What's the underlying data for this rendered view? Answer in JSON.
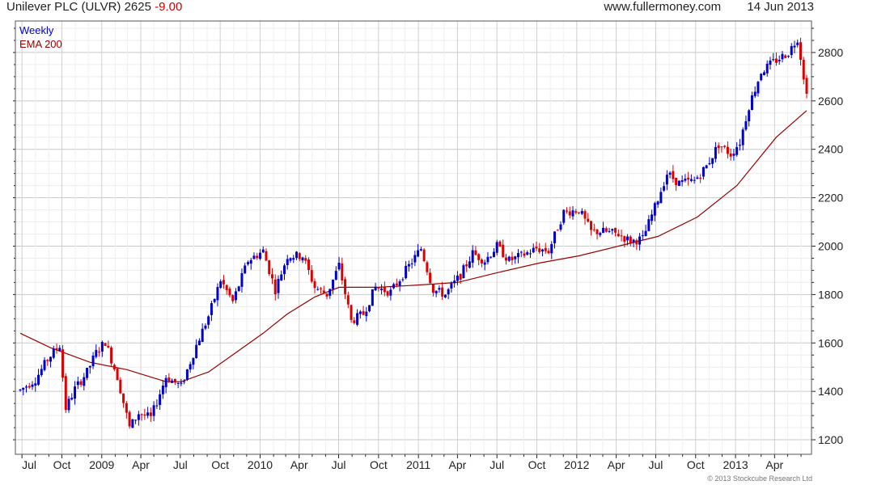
{
  "header": {
    "title": "Unilever PLC (ULVR) 2625",
    "change": "-9.00",
    "site": "www.fullermoney.com",
    "date": "14 Jun 2013"
  },
  "legend": {
    "series1": "Weekly",
    "series2": "EMA 200"
  },
  "copyright": "© 2013 Stockcube Research Ltd",
  "colors": {
    "up": "#0000cc",
    "down": "#dd0000",
    "ema": "#990000",
    "grid": "#d6d6d6",
    "axis": "#222222"
  },
  "chart_data": {
    "type": "candlestick",
    "title": "Unilever PLC (ULVR) 2625 -9.00",
    "x_tick_labels": [
      "Jul",
      "Oct",
      "2009",
      "Apr",
      "Jul",
      "Oct",
      "2010",
      "Apr",
      "Jul",
      "Oct",
      "2011",
      "Apr",
      "Jul",
      "Oct",
      "2012",
      "Apr",
      "Jul",
      "Oct",
      "2013",
      "Apr"
    ],
    "x_tick_dates": [
      "2008-07-01",
      "2008-10-01",
      "2009-01-01",
      "2009-04-01",
      "2009-07-01",
      "2009-10-01",
      "2010-01-01",
      "2010-04-01",
      "2010-07-01",
      "2010-10-01",
      "2011-01-01",
      "2011-04-01",
      "2011-07-01",
      "2011-10-01",
      "2012-01-01",
      "2012-04-01",
      "2012-07-01",
      "2012-10-01",
      "2013-01-01",
      "2013-04-01"
    ],
    "x_range": [
      "2008-06-27",
      "2013-06-14"
    ],
    "y_ticks": [
      1200,
      1400,
      1600,
      1800,
      2000,
      2200,
      2400,
      2600,
      2800
    ],
    "ylim": [
      1140,
      2930
    ],
    "grid": true,
    "legend_position": "top-left",
    "series": [
      {
        "name": "Weekly",
        "points": [
          [
            "2008-06-27",
            1405
          ],
          [
            "2008-08-01",
            1450
          ],
          [
            "2008-09-01",
            1540
          ],
          [
            "2008-09-26",
            1590
          ],
          [
            "2008-10-10",
            1330
          ],
          [
            "2008-10-31",
            1410
          ],
          [
            "2008-11-28",
            1480
          ],
          [
            "2008-12-19",
            1560
          ],
          [
            "2009-01-09",
            1605
          ],
          [
            "2009-02-06",
            1460
          ],
          [
            "2009-03-06",
            1250
          ],
          [
            "2009-03-27",
            1310
          ],
          [
            "2009-04-24",
            1290
          ],
          [
            "2009-05-29",
            1460
          ],
          [
            "2009-07-03",
            1420
          ],
          [
            "2009-08-07",
            1590
          ],
          [
            "2009-09-04",
            1710
          ],
          [
            "2009-10-02",
            1860
          ],
          [
            "2009-10-30",
            1770
          ],
          [
            "2009-12-04",
            1940
          ],
          [
            "2010-01-08",
            1980
          ],
          [
            "2010-02-05",
            1820
          ],
          [
            "2010-03-05",
            1960
          ],
          [
            "2010-04-09",
            1960
          ],
          [
            "2010-05-07",
            1830
          ],
          [
            "2010-06-04",
            1800
          ],
          [
            "2010-07-02",
            1920
          ],
          [
            "2010-07-30",
            1690
          ],
          [
            "2010-08-27",
            1720
          ],
          [
            "2010-09-24",
            1830
          ],
          [
            "2010-10-29",
            1810
          ],
          [
            "2010-12-03",
            1900
          ],
          [
            "2011-01-07",
            1990
          ],
          [
            "2011-02-04",
            1820
          ],
          [
            "2011-03-04",
            1800
          ],
          [
            "2011-04-08",
            1880
          ],
          [
            "2011-05-06",
            1970
          ],
          [
            "2011-06-03",
            1940
          ],
          [
            "2011-07-01",
            2000
          ],
          [
            "2011-07-29",
            1940
          ],
          [
            "2011-08-26",
            1960
          ],
          [
            "2011-09-30",
            1990
          ],
          [
            "2011-10-28",
            1980
          ],
          [
            "2011-12-02",
            2140
          ],
          [
            "2012-01-06",
            2150
          ],
          [
            "2012-02-03",
            2060
          ],
          [
            "2012-03-02",
            2060
          ],
          [
            "2012-04-06",
            2050
          ],
          [
            "2012-05-04",
            2020
          ],
          [
            "2012-06-01",
            2030
          ],
          [
            "2012-06-29",
            2160
          ],
          [
            "2012-07-27",
            2300
          ],
          [
            "2012-08-24",
            2260
          ],
          [
            "2012-09-28",
            2270
          ],
          [
            "2012-10-26",
            2330
          ],
          [
            "2012-11-23",
            2420
          ],
          [
            "2012-12-21",
            2380
          ],
          [
            "2013-01-11",
            2430
          ],
          [
            "2013-02-01",
            2580
          ],
          [
            "2013-03-01",
            2720
          ],
          [
            "2013-03-29",
            2760
          ],
          [
            "2013-05-03",
            2800
          ],
          [
            "2013-05-24",
            2860
          ],
          [
            "2013-06-14",
            2625
          ]
        ]
      },
      {
        "name": "EMA 200",
        "points": [
          [
            "2008-06-27",
            1640
          ],
          [
            "2008-09-05",
            1580
          ],
          [
            "2008-12-05",
            1520
          ],
          [
            "2009-02-27",
            1490
          ],
          [
            "2009-05-29",
            1440
          ],
          [
            "2009-07-03",
            1440
          ],
          [
            "2009-09-04",
            1480
          ],
          [
            "2009-11-06",
            1560
          ],
          [
            "2010-01-08",
            1640
          ],
          [
            "2010-03-05",
            1720
          ],
          [
            "2010-05-07",
            1790
          ],
          [
            "2010-07-02",
            1830
          ],
          [
            "2010-10-01",
            1830
          ],
          [
            "2011-01-07",
            1840
          ],
          [
            "2011-04-01",
            1850
          ],
          [
            "2011-07-01",
            1890
          ],
          [
            "2011-10-07",
            1930
          ],
          [
            "2012-01-06",
            1960
          ],
          [
            "2012-04-06",
            2000
          ],
          [
            "2012-07-06",
            2040
          ],
          [
            "2012-10-05",
            2120
          ],
          [
            "2013-01-04",
            2250
          ],
          [
            "2013-04-05",
            2450
          ],
          [
            "2013-06-14",
            2560
          ]
        ]
      }
    ]
  }
}
